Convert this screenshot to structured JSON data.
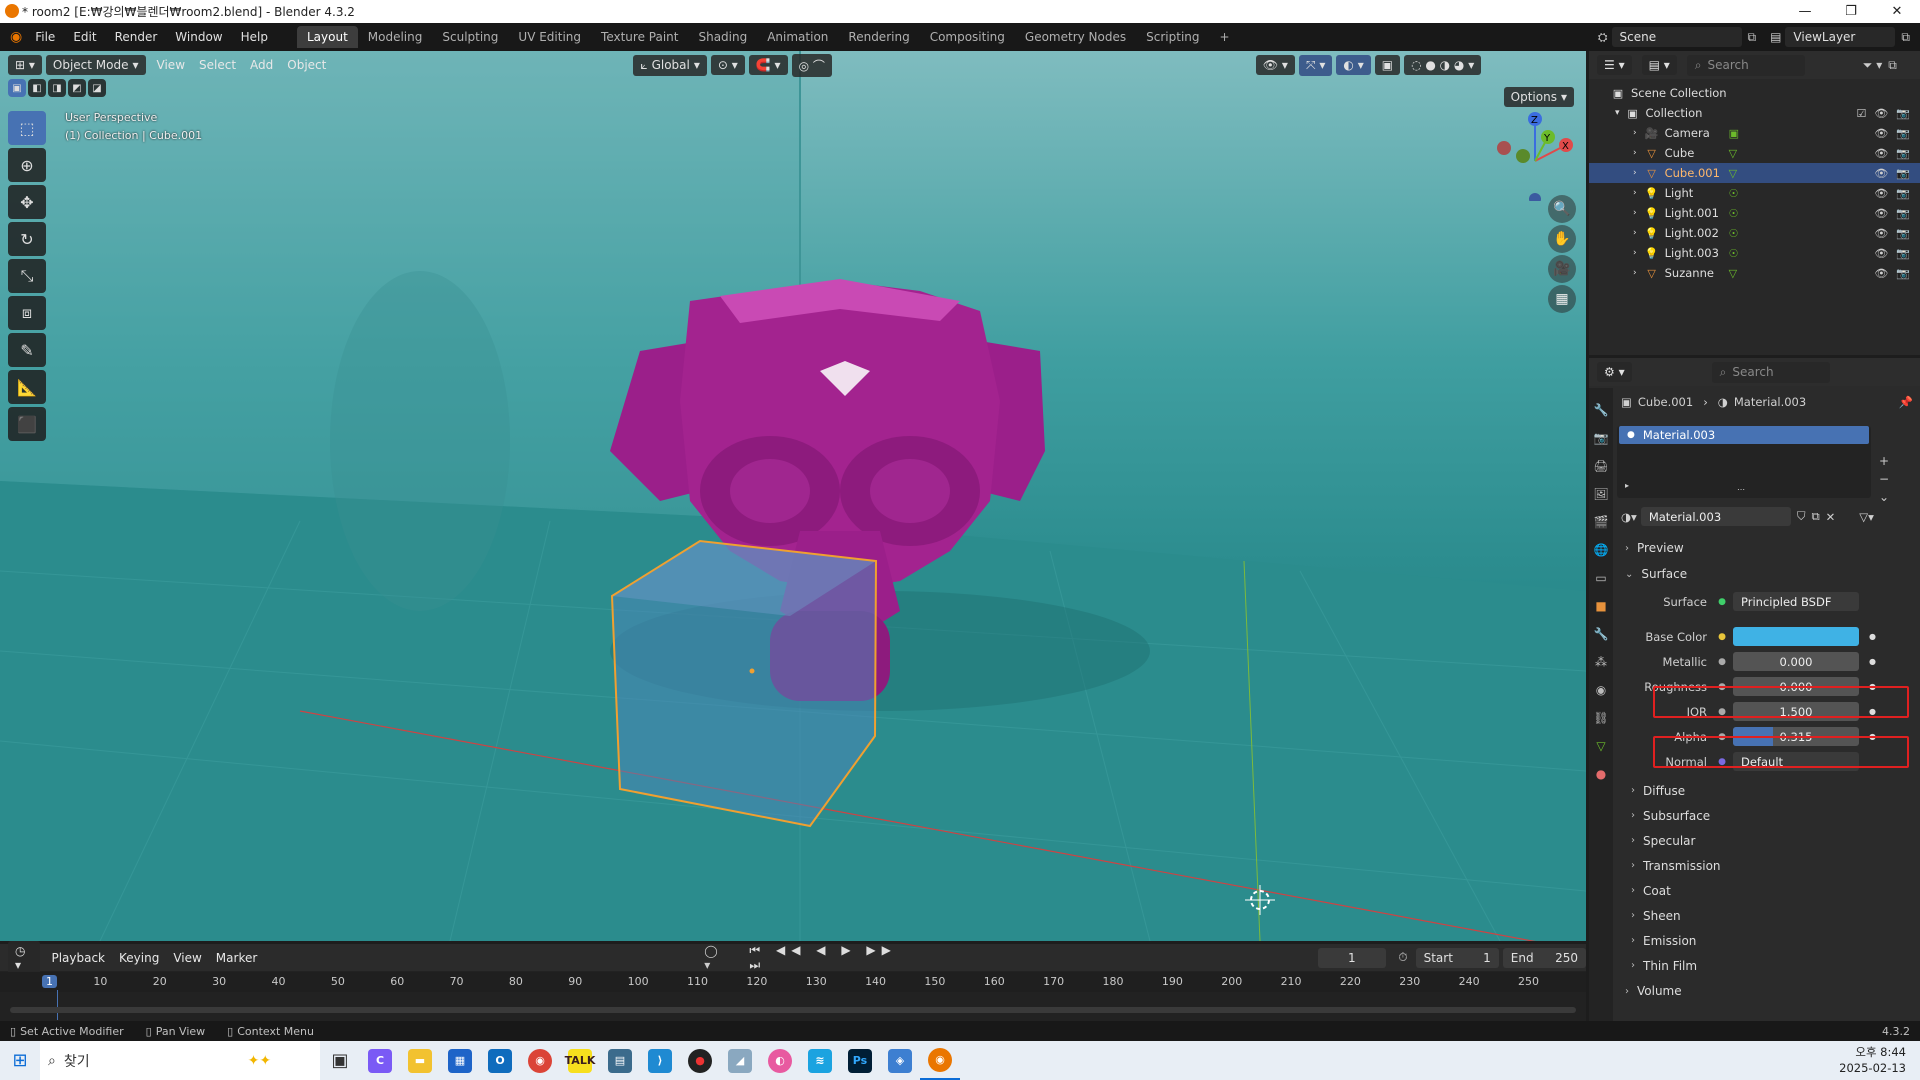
{
  "window": {
    "title": "* room2 [E:₩강의₩블렌더₩room2.blend] - Blender 4.3.2"
  },
  "menu": {
    "items": [
      "File",
      "Edit",
      "Render",
      "Window",
      "Help"
    ]
  },
  "workspaces": [
    "Layout",
    "Modeling",
    "Sculpting",
    "UV Editing",
    "Texture Paint",
    "Shading",
    "Animation",
    "Rendering",
    "Compositing",
    "Geometry Nodes",
    "Scripting"
  ],
  "active_workspace": "Layout",
  "scene": {
    "name": "Scene",
    "view_layer": "ViewLayer"
  },
  "viewport": {
    "mode": "Object Mode",
    "menus": [
      "View",
      "Select",
      "Add",
      "Object"
    ],
    "transform_orientation": "Global",
    "options_label": "Options",
    "overlay_line1": "User Perspective",
    "overlay_line2": "(1) Collection | Cube.001",
    "gizmo_axes": [
      "Z",
      "Y",
      "X"
    ]
  },
  "timeline": {
    "menus": [
      "Playback",
      "Keying",
      "View",
      "Marker"
    ],
    "current_frame": "1",
    "start_label": "Start",
    "start": "1",
    "end_label": "End",
    "end": "250",
    "ruler_ticks": [
      "1",
      "10",
      "20",
      "30",
      "40",
      "50",
      "60",
      "70",
      "80",
      "90",
      "100",
      "110",
      "120",
      "130",
      "140",
      "150",
      "160",
      "170",
      "180",
      "190",
      "200",
      "210",
      "220",
      "230",
      "240",
      "250"
    ]
  },
  "status": {
    "items": [
      "Set Active Modifier",
      "Pan View",
      "Context Menu"
    ],
    "version": "4.3.2"
  },
  "outliner": {
    "search_placeholder": "Search",
    "root": "Scene Collection",
    "collection": "Collection",
    "items": [
      {
        "name": "Camera",
        "type": "camera"
      },
      {
        "name": "Cube",
        "type": "mesh"
      },
      {
        "name": "Cube.001",
        "type": "mesh",
        "selected": true
      },
      {
        "name": "Light",
        "type": "light"
      },
      {
        "name": "Light.001",
        "type": "light"
      },
      {
        "name": "Light.002",
        "type": "light"
      },
      {
        "name": "Light.003",
        "type": "light"
      },
      {
        "name": "Suzanne",
        "type": "mesh"
      }
    ]
  },
  "properties": {
    "search_placeholder": "Search",
    "breadcrumb_object": "Cube.001",
    "breadcrumb_material": "Material.003",
    "slot_name": "Material.003",
    "material_name": "Material.003",
    "sections": {
      "preview": "Preview",
      "surface": "Surface"
    },
    "surface_label": "Surface",
    "surface_value": "Principled BSDF",
    "fields": [
      {
        "label": "Base Color",
        "value": "",
        "kind": "color",
        "color": "#3fb2e5"
      },
      {
        "label": "Metallic",
        "value": "0.000",
        "kind": "slider"
      },
      {
        "label": "Roughness",
        "value": "0.000",
        "kind": "slider"
      },
      {
        "label": "IOR",
        "value": "1.500",
        "kind": "slider"
      },
      {
        "label": "Alpha",
        "value": "0.315",
        "kind": "slider",
        "fill": 0.315
      },
      {
        "label": "Normal",
        "value": "Default",
        "kind": "link"
      }
    ],
    "subsections": [
      "Diffuse",
      "Subsurface",
      "Specular",
      "Transmission",
      "Coat",
      "Sheen",
      "Emission",
      "Thin Film"
    ],
    "volume": "Volume"
  },
  "taskbar": {
    "search": "찾기",
    "time": "오후 8:44",
    "date": "2025-02-13"
  }
}
